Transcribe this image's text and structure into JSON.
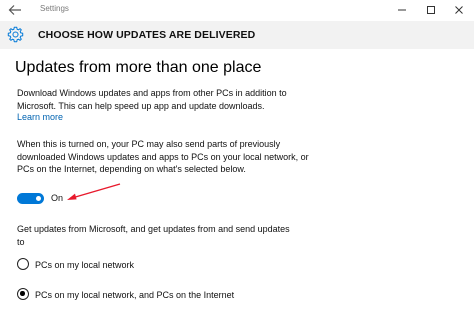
{
  "window": {
    "app_title": "Settings",
    "back_icon": "back-arrow-icon",
    "controls": [
      "minimize-icon",
      "maximize-icon",
      "close-icon"
    ]
  },
  "header": {
    "icon": "gear-icon",
    "title": "CHOOSE HOW UPDATES ARE DELIVERED"
  },
  "main": {
    "title": "Updates from more than one place",
    "description": "Download Windows updates and apps from other PCs in addition to Microsoft. This can help speed up app and update downloads.",
    "learn_more": "Learn more",
    "info": "When this is turned on, your PC may also send parts of previously downloaded Windows updates and apps to PCs on your local network, or PCs on the Internet, depending on what's selected below.",
    "toggle": {
      "state": "On",
      "checked": true
    },
    "source_prompt": "Get updates from Microsoft, and get updates from and send updates to",
    "options": [
      {
        "label": "PCs on my local network",
        "selected": false
      },
      {
        "label": "PCs on my local network, and PCs on the Internet",
        "selected": true
      }
    ]
  },
  "colors": {
    "accent": "#0078d7",
    "link": "#0063b1",
    "header_bg": "#f2f2f2",
    "annotation_arrow": "#e8192c"
  }
}
